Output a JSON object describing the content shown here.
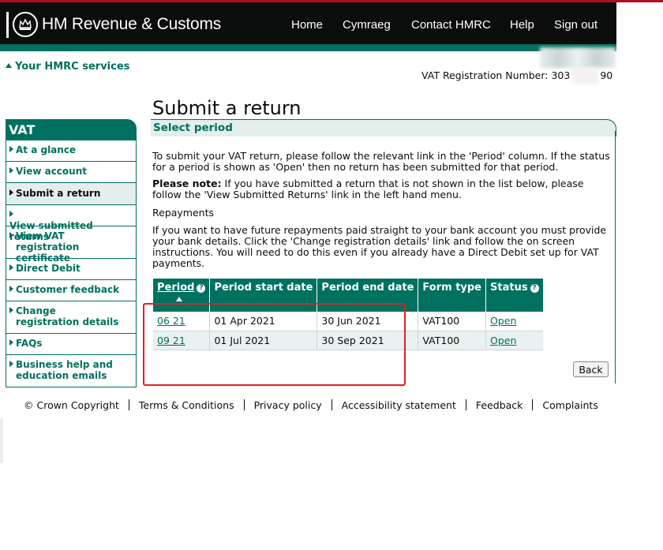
{
  "header": {
    "brand": "HM Revenue & Customs",
    "nav": [
      "Home",
      "Cymraeg",
      "Contact HMRC",
      "Help",
      "Sign out"
    ]
  },
  "services_link": "Your HMRC services",
  "vat_number_label": "VAT Registration Number: 303",
  "vat_number_end": "90",
  "page": {
    "title": "Submit a return",
    "subtitle": "Select period",
    "intro": "To submit your VAT return, please follow the relevant link in the 'Period' column. If the status for a period is shown as 'Open' then no return has been submitted for that period.",
    "note_label": "Please note:",
    "note_text": " If you have submitted a return that is not shown in the list below, please follow the 'View Submitted Returns' link in the left hand menu.",
    "repay_heading": "Repayments",
    "repay_text": "If you want to have future repayments paid straight to your bank account you must provide your bank details. Click the 'Change registration details' link and follow the on screen instructions. You will need to do this even if you already have a Direct Debit set up for VAT payments.",
    "back_label": "Back"
  },
  "table": {
    "headers": [
      "Period",
      "Period start date",
      "Period end date",
      "Form type",
      "Status"
    ],
    "help_glyph": "?",
    "rows": [
      [
        "06 21",
        "01 Apr 2021",
        "30 Jun 2021",
        "VAT100",
        "Open"
      ],
      [
        "09 21",
        "01 Jul 2021",
        "30 Sep 2021",
        "VAT100",
        "Open"
      ]
    ]
  },
  "sidebar": {
    "heading": "VAT",
    "items": [
      "At a glance",
      "View account",
      "Submit a return",
      "View submitted returns",
      "View VAT registration certificate",
      "Direct Debit",
      "Customer feedback",
      "Change registration details",
      "FAQs",
      "Business help and education emails"
    ]
  },
  "footer": [
    "© Crown Copyright",
    "Terms & Conditions",
    "Privacy policy",
    "Accessibility statement",
    "Feedback",
    "Complaints"
  ],
  "colors": {
    "brand_green": "#00705f",
    "header_black": "#0b0c0c",
    "highlight_red": "#e41e26"
  }
}
